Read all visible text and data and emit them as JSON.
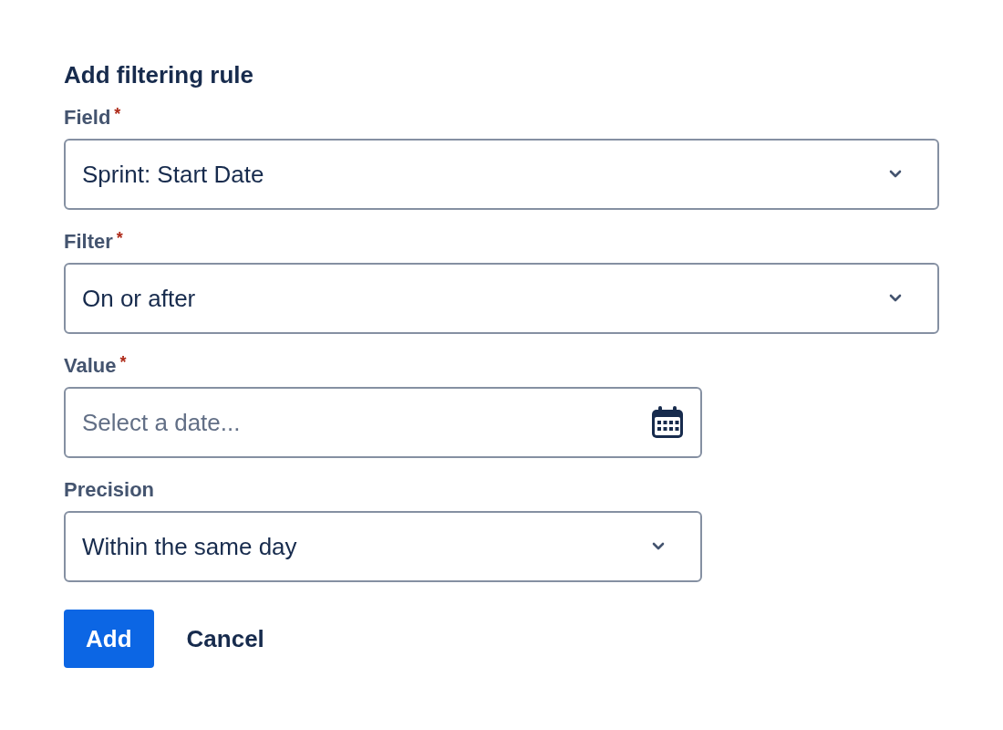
{
  "title": "Add filtering rule",
  "fields": [
    {
      "label": "Field",
      "required_mark": "*",
      "kind": "select",
      "value": "Sprint: Start Date"
    },
    {
      "label": "Filter",
      "required_mark": "*",
      "kind": "select",
      "value": "On or after"
    },
    {
      "label": "Value",
      "required_mark": "*",
      "kind": "date",
      "placeholder": "Select a date..."
    },
    {
      "label": "Precision",
      "kind": "select",
      "value": "Within the same day"
    }
  ],
  "buttons": [
    {
      "label": "Add",
      "kind": "primary"
    },
    {
      "label": "Cancel",
      "kind": "subtle"
    }
  ]
}
